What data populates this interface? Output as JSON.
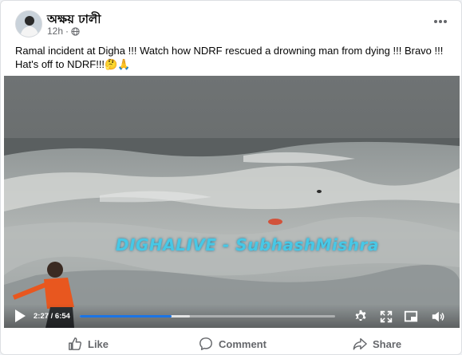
{
  "post": {
    "author": "অক্ষয় ঢালী",
    "time": "12h",
    "privacy_icon": "globe-icon",
    "caption": "Ramal incident at Digha !!! Watch how NDRF rescued a drowning man from dying !!! Bravo !!! Hat's off to NDRF!!!🤔🙏"
  },
  "video": {
    "watermark": "DIGHALIVE - SubhashMishra",
    "time_display": "2:27 / 6:54",
    "progress": 0.36,
    "buffered": 0.43,
    "progress_color": "#1b74e4"
  },
  "actions": {
    "like": "Like",
    "comment": "Comment",
    "share": "Share"
  }
}
